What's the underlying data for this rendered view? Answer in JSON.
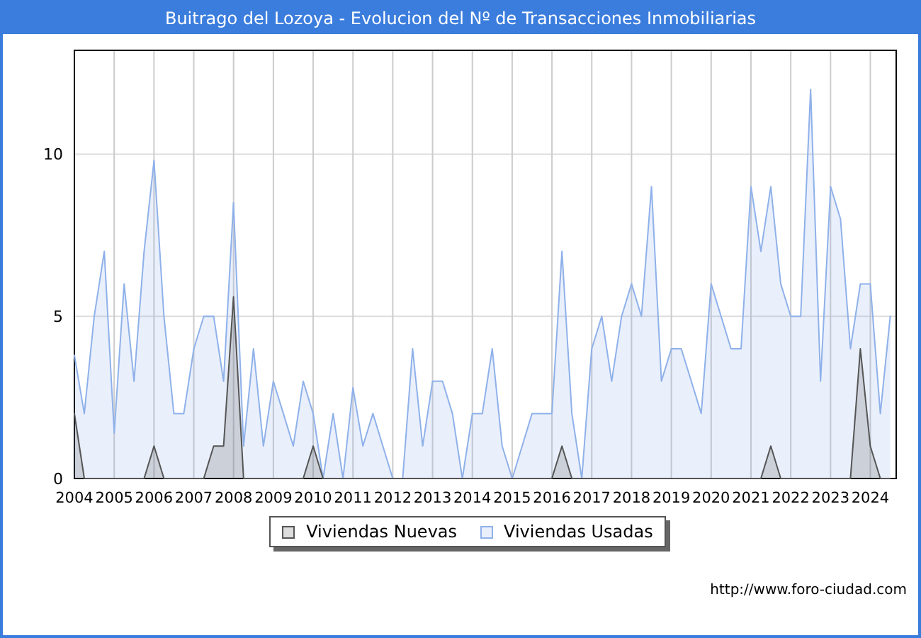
{
  "title": "Buitrago del Lozoya - Evolucion del Nº de Transacciones Inmobiliarias",
  "chart_data": {
    "type": "area",
    "grid": true,
    "xlim": [
      2004,
      2024.65
    ],
    "ylim": [
      0,
      13.2
    ],
    "xticks": [
      2004,
      2005,
      2006,
      2007,
      2008,
      2009,
      2010,
      2011,
      2012,
      2013,
      2014,
      2015,
      2016,
      2017,
      2018,
      2019,
      2020,
      2021,
      2022,
      2023,
      2024
    ],
    "yticks": [
      0,
      5,
      10
    ],
    "x": [
      2004,
      2004.25,
      2004.5,
      2004.75,
      2005,
      2005.25,
      2005.5,
      2005.75,
      2006,
      2006.25,
      2006.5,
      2006.75,
      2007,
      2007.25,
      2007.5,
      2007.75,
      2008,
      2008.25,
      2008.5,
      2008.75,
      2009,
      2009.25,
      2009.5,
      2009.75,
      2010,
      2010.25,
      2010.5,
      2010.75,
      2011,
      2011.25,
      2011.5,
      2011.75,
      2012,
      2012.25,
      2012.5,
      2012.75,
      2013,
      2013.25,
      2013.5,
      2013.75,
      2014,
      2014.25,
      2014.5,
      2014.75,
      2015,
      2015.25,
      2015.5,
      2015.75,
      2016,
      2016.25,
      2016.5,
      2016.75,
      2017,
      2017.25,
      2017.5,
      2017.75,
      2018,
      2018.25,
      2018.5,
      2018.75,
      2019,
      2019.25,
      2019.5,
      2019.75,
      2020,
      2020.25,
      2020.5,
      2020.75,
      2021,
      2021.25,
      2021.5,
      2021.75,
      2022,
      2022.25,
      2022.5,
      2022.75,
      2023,
      2023.25,
      2023.5,
      2023.75,
      2024,
      2024.25,
      2024.5
    ],
    "series": [
      {
        "name": "Viviendas Nuevas",
        "color": "#555555",
        "values": [
          2,
          0,
          0,
          0,
          0,
          0,
          0,
          0,
          1,
          0,
          0,
          0,
          0,
          0,
          1,
          1,
          5.6,
          0,
          0,
          0,
          0,
          0,
          0,
          0,
          1,
          0,
          0,
          0,
          0,
          0,
          0,
          0,
          0,
          0,
          0,
          0,
          0,
          0,
          0,
          0,
          0,
          0,
          0,
          0,
          0,
          0,
          0,
          0,
          0,
          1,
          0,
          0,
          0,
          0,
          0,
          0,
          0,
          0,
          0,
          0,
          0,
          0,
          0,
          0,
          0,
          0,
          0,
          0,
          0,
          0,
          1,
          0,
          0,
          0,
          0,
          0,
          0,
          0,
          0,
          4,
          1,
          0,
          0
        ]
      },
      {
        "name": "Viviendas Usadas",
        "color": "#8fb1ea",
        "values": [
          3.8,
          2,
          5,
          7,
          1.4,
          6,
          3,
          7,
          9.8,
          5,
          2,
          2,
          4,
          5,
          5,
          3,
          8.5,
          1,
          4,
          1,
          3,
          2,
          1,
          3,
          2,
          0,
          2,
          0,
          2.8,
          1,
          2,
          1,
          0,
          0,
          4,
          1,
          3,
          3,
          2,
          0,
          2,
          2,
          4,
          1,
          0,
          1,
          2,
          2,
          2,
          7,
          2,
          0,
          4,
          5,
          3,
          5,
          6,
          5,
          9,
          3,
          4,
          4,
          3,
          2,
          6,
          5,
          4,
          4,
          9,
          7,
          9,
          6,
          5,
          5,
          12,
          3,
          9,
          8,
          4,
          6,
          6,
          2,
          5
        ]
      }
    ]
  },
  "url": "http://www.foro-ciudad.com"
}
